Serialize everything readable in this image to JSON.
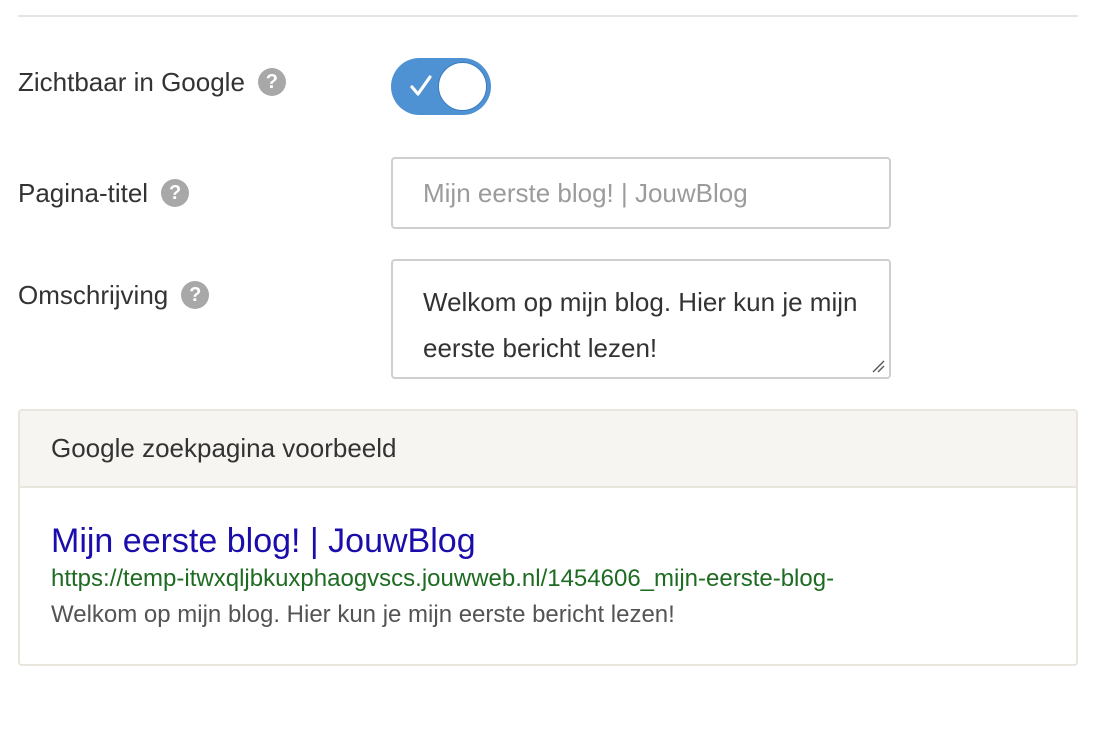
{
  "settings": {
    "visible_in_google": {
      "label": "Zichtbaar in Google",
      "help_icon": "question-mark",
      "enabled": true,
      "toggle_color": "#4f92d3"
    },
    "page_title": {
      "label": "Pagina-titel",
      "help_icon": "question-mark",
      "value": "",
      "placeholder": "Mijn eerste blog! | JouwBlog"
    },
    "description": {
      "label": "Omschrijving",
      "help_icon": "question-mark",
      "value": "Welkom op mijn blog. Hier kun je mijn eerste bericht lezen!"
    }
  },
  "preview": {
    "header": "Google zoekpagina voorbeeld",
    "result": {
      "title": "Mijn eerste blog! | JouwBlog",
      "url": "https://temp-itwxqljbkuxphaogvscs.jouwweb.nl/1454606_mijn-eerste-blog-",
      "description": "Welkom op mijn blog. Hier kun je mijn eerste bericht lezen!",
      "title_color": "#1a0dab",
      "url_color": "#1e6b22",
      "description_color": "#545454"
    }
  },
  "help_glyph": "?"
}
